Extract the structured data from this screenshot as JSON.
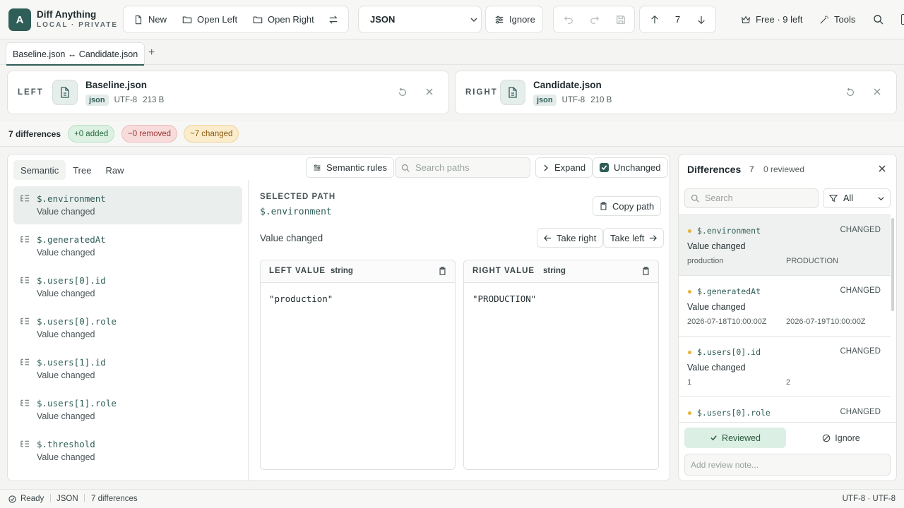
{
  "app": {
    "logo_letter": "A",
    "title": "Diff Anything",
    "subtitle": "LOCAL · PRIVATE"
  },
  "toolbar": {
    "new_label": "New",
    "open_left_label": "Open Left",
    "open_right_label": "Open Right",
    "format_value": "JSON",
    "ignore_label": "Ignore",
    "nav_index": "7",
    "plan_label": "Free · 9 left",
    "tools_label": "Tools"
  },
  "tabs": [
    {
      "label": "Baseline.json ↔ Candidate.json"
    }
  ],
  "tab_add_label": "+",
  "files": {
    "left": {
      "side": "LEFT",
      "name": "Baseline.json",
      "type": "json",
      "encoding": "UTF-8",
      "size": "213 B"
    },
    "right": {
      "side": "RIGHT",
      "name": "Candidate.json",
      "type": "json",
      "encoding": "UTF-8",
      "size": "210 B"
    }
  },
  "summary": {
    "count": "7 differences",
    "added": "+0 added",
    "removed": "−0 removed",
    "changed": "~7 changed"
  },
  "colors": {
    "accent": "#2f5d57",
    "added_bg": "#dcf1e2",
    "removed_bg": "#f8dcdc",
    "changed_bg": "#fbeccc",
    "changed_dot": "#e8b23a"
  },
  "main": {
    "mode_tabs": [
      "Semantic",
      "Tree",
      "Raw"
    ],
    "active_mode": "Semantic",
    "semantic_rules_label": "Semantic rules",
    "search_placeholder": "Search paths",
    "expand_label": "Expand",
    "unchanged_label": "Unchanged",
    "unchanged_checked": true,
    "paths": [
      {
        "path": "$.environment",
        "desc": "Value changed"
      },
      {
        "path": "$.generatedAt",
        "desc": "Value changed"
      },
      {
        "path": "$.users[0].id",
        "desc": "Value changed"
      },
      {
        "path": "$.users[0].role",
        "desc": "Value changed"
      },
      {
        "path": "$.users[1].id",
        "desc": "Value changed"
      },
      {
        "path": "$.users[1].role",
        "desc": "Value changed"
      },
      {
        "path": "$.threshold",
        "desc": "Value changed"
      }
    ],
    "detail": {
      "selected_label": "SELECTED PATH",
      "path": "$.environment",
      "copy_path_label": "Copy path",
      "description": "Value changed",
      "take_right_label": "Take right",
      "take_left_label": "Take left",
      "left_title": "LEFT VALUE",
      "left_type": "string",
      "left_value": "\"production\"",
      "right_title": "RIGHT VALUE",
      "right_type": "string",
      "right_value": "\"PRODUCTION\""
    }
  },
  "panel": {
    "title": "Differences",
    "count": "7",
    "reviewed": "0 reviewed",
    "search_placeholder": "Search",
    "filter_value": "All",
    "items": [
      {
        "path": "$.environment",
        "status": "CHANGED",
        "desc": "Value changed",
        "left": "production",
        "right": "PRODUCTION"
      },
      {
        "path": "$.generatedAt",
        "status": "CHANGED",
        "desc": "Value changed",
        "left": "2026-07-18T10:00:00Z",
        "right": "2026-07-19T10:00:00Z"
      },
      {
        "path": "$.users[0].id",
        "status": "CHANGED",
        "desc": "Value changed",
        "left": "1",
        "right": "2"
      },
      {
        "path": "$.users[0].role",
        "status": "CHANGED",
        "desc": "",
        "left": "",
        "right": ""
      }
    ],
    "reviewed_btn": "Reviewed",
    "ignore_btn": "Ignore",
    "note_placeholder": "Add review note..."
  },
  "status": {
    "ready": "Ready",
    "format": "JSON",
    "diffs": "7 differences",
    "encoding": "UTF-8 · UTF-8"
  }
}
